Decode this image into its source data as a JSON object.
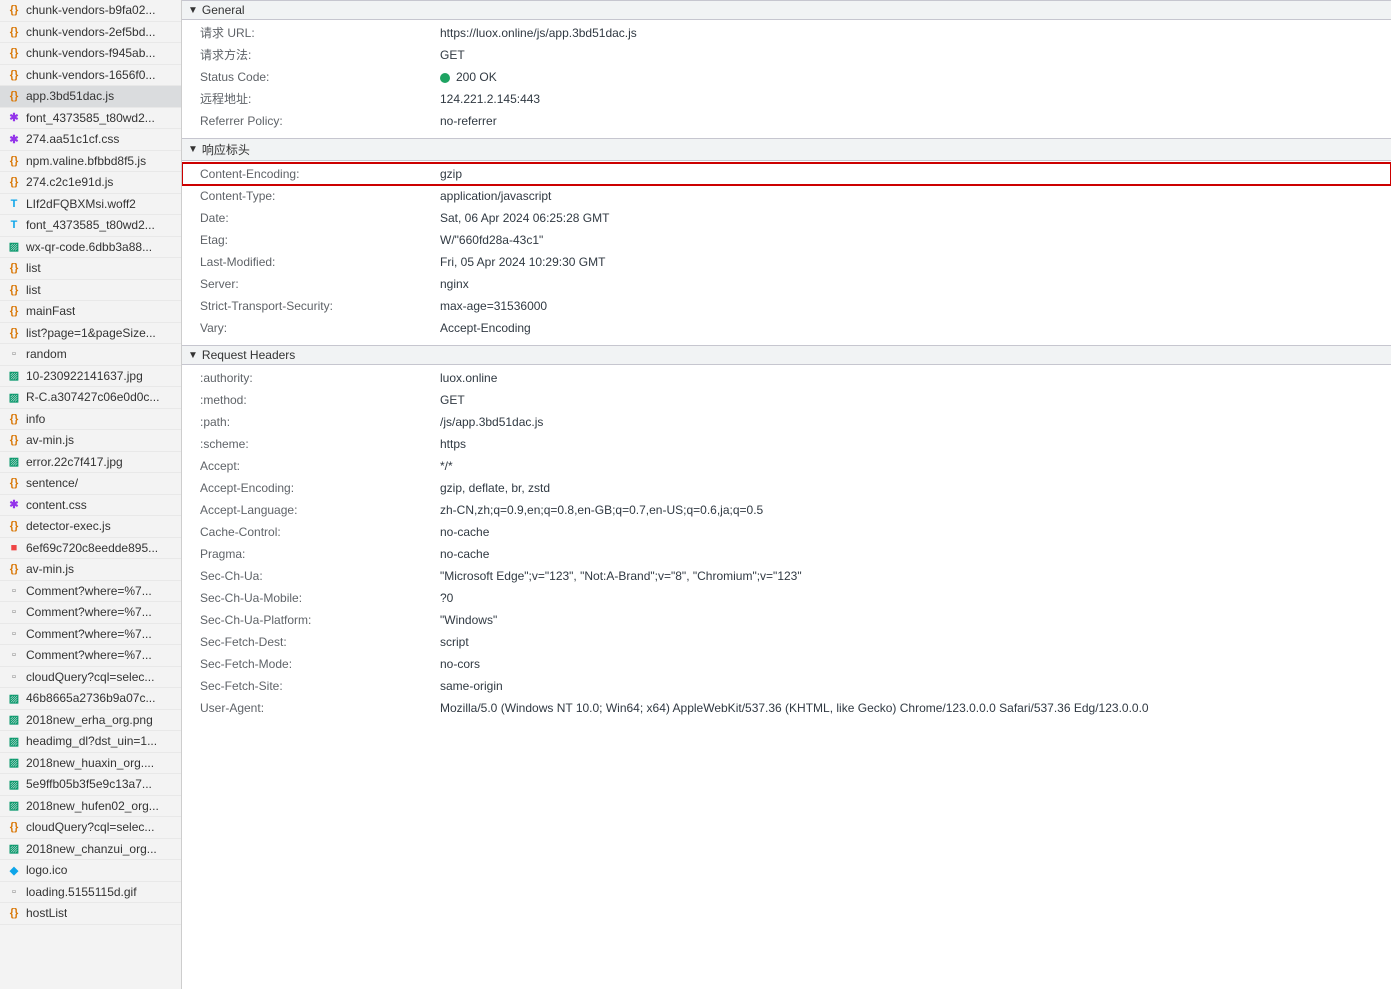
{
  "sidebar": {
    "items": [
      {
        "label": "chunk-vendors-b9fa02...",
        "icon": "js",
        "name": "file-chunk-vendors-1"
      },
      {
        "label": "chunk-vendors-2ef5bd...",
        "icon": "js",
        "name": "file-chunk-vendors-2"
      },
      {
        "label": "chunk-vendors-f945ab...",
        "icon": "js",
        "name": "file-chunk-vendors-3"
      },
      {
        "label": "chunk-vendors-1656f0...",
        "icon": "js",
        "name": "file-chunk-vendors-4"
      },
      {
        "label": "app.3bd51dac.js",
        "icon": "js",
        "name": "file-app-js",
        "selected": true
      },
      {
        "label": "font_4373585_t80wd2...",
        "icon": "css",
        "name": "file-font-css-1"
      },
      {
        "label": "274.aa51c1cf.css",
        "icon": "css",
        "name": "file-274-css"
      },
      {
        "label": "npm.valine.bfbbd8f5.js",
        "icon": "js",
        "name": "file-npm-valine"
      },
      {
        "label": "274.c2c1e91d.js",
        "icon": "js",
        "name": "file-274-js"
      },
      {
        "label": "LIf2dFQBXMsi.woff2",
        "icon": "font",
        "name": "file-woff2"
      },
      {
        "label": "font_4373585_t80wd2...",
        "icon": "font",
        "name": "file-font-2"
      },
      {
        "label": "wx-qr-code.6dbb3a88...",
        "icon": "img",
        "name": "file-wx-qr"
      },
      {
        "label": "list",
        "icon": "xhr",
        "name": "file-list-1"
      },
      {
        "label": "list",
        "icon": "xhr",
        "name": "file-list-2"
      },
      {
        "label": "mainFast",
        "icon": "xhr",
        "name": "file-mainfast"
      },
      {
        "label": "list?page=1&pageSize...",
        "icon": "xhr",
        "name": "file-list-page"
      },
      {
        "label": "random",
        "icon": "doc",
        "name": "file-random"
      },
      {
        "label": "10-230922141637.jpg",
        "icon": "img",
        "name": "file-jpg-1"
      },
      {
        "label": "R-C.a307427c06e0d0c...",
        "icon": "img",
        "name": "file-rc-img"
      },
      {
        "label": "info",
        "icon": "xhr",
        "name": "file-info"
      },
      {
        "label": "av-min.js",
        "icon": "js",
        "name": "file-avmin-1"
      },
      {
        "label": "error.22c7f417.jpg",
        "icon": "img",
        "name": "file-error-jpg"
      },
      {
        "label": "sentence/",
        "icon": "xhr",
        "name": "file-sentence"
      },
      {
        "label": "content.css",
        "icon": "css",
        "name": "file-content-css"
      },
      {
        "label": "detector-exec.js",
        "icon": "js",
        "name": "file-detector"
      },
      {
        "label": "6ef69c720c8eedde895...",
        "icon": "media",
        "name": "file-media-1"
      },
      {
        "label": "av-min.js",
        "icon": "js",
        "name": "file-avmin-2"
      },
      {
        "label": "Comment?where=%7...",
        "icon": "doc",
        "name": "file-comment-1"
      },
      {
        "label": "Comment?where=%7...",
        "icon": "doc",
        "name": "file-comment-2"
      },
      {
        "label": "Comment?where=%7...",
        "icon": "doc",
        "name": "file-comment-3"
      },
      {
        "label": "Comment?where=%7...",
        "icon": "doc",
        "name": "file-comment-4"
      },
      {
        "label": "cloudQuery?cql=selec...",
        "icon": "doc",
        "name": "file-cloudquery-1"
      },
      {
        "label": "46b8665a2736b9a07c...",
        "icon": "img",
        "name": "file-img-46b"
      },
      {
        "label": "2018new_erha_org.png",
        "icon": "img",
        "name": "file-erha"
      },
      {
        "label": "headimg_dl?dst_uin=1...",
        "icon": "img",
        "name": "file-headimg"
      },
      {
        "label": "2018new_huaxin_org....",
        "icon": "img",
        "name": "file-huaxin"
      },
      {
        "label": "5e9ffb05b3f5e9c13a7...",
        "icon": "img",
        "name": "file-5e9"
      },
      {
        "label": "2018new_hufen02_org...",
        "icon": "img",
        "name": "file-hufen"
      },
      {
        "label": "cloudQuery?cql=selec...",
        "icon": "xhr",
        "name": "file-cloudquery-2"
      },
      {
        "label": "2018new_chanzui_org...",
        "icon": "img",
        "name": "file-chanzui"
      },
      {
        "label": "logo.ico",
        "icon": "fav",
        "name": "file-logo-ico"
      },
      {
        "label": "loading.5155115d.gif",
        "icon": "gif",
        "name": "file-loading-gif"
      },
      {
        "label": "hostList",
        "icon": "xhr",
        "name": "file-hostlist"
      }
    ]
  },
  "sections": {
    "general": {
      "title": "General",
      "rows": [
        {
          "k": "请求 URL:",
          "v": "https://luox.online/js/app.3bd51dac.js"
        },
        {
          "k": "请求方法:",
          "v": "GET"
        },
        {
          "k": "Status Code:",
          "v": "200 OK",
          "status": true
        },
        {
          "k": "远程地址:",
          "v": "124.221.2.145:443"
        },
        {
          "k": "Referrer Policy:",
          "v": "no-referrer"
        }
      ]
    },
    "response": {
      "title": "响应标头",
      "rows": [
        {
          "k": "Content-Encoding:",
          "v": "gzip",
          "highlight": true
        },
        {
          "k": "Content-Type:",
          "v": "application/javascript"
        },
        {
          "k": "Date:",
          "v": "Sat, 06 Apr 2024 06:25:28 GMT"
        },
        {
          "k": "Etag:",
          "v": "W/\"660fd28a-43c1\""
        },
        {
          "k": "Last-Modified:",
          "v": "Fri, 05 Apr 2024 10:29:30 GMT"
        },
        {
          "k": "Server:",
          "v": "nginx"
        },
        {
          "k": "Strict-Transport-Security:",
          "v": "max-age=31536000"
        },
        {
          "k": "Vary:",
          "v": "Accept-Encoding"
        }
      ]
    },
    "request": {
      "title": "Request Headers",
      "rows": [
        {
          "k": ":authority:",
          "v": "luox.online"
        },
        {
          "k": ":method:",
          "v": "GET"
        },
        {
          "k": ":path:",
          "v": "/js/app.3bd51dac.js"
        },
        {
          "k": ":scheme:",
          "v": "https"
        },
        {
          "k": "Accept:",
          "v": "*/*"
        },
        {
          "k": "Accept-Encoding:",
          "v": "gzip, deflate, br, zstd"
        },
        {
          "k": "Accept-Language:",
          "v": "zh-CN,zh;q=0.9,en;q=0.8,en-GB;q=0.7,en-US;q=0.6,ja;q=0.5"
        },
        {
          "k": "Cache-Control:",
          "v": "no-cache"
        },
        {
          "k": "Pragma:",
          "v": "no-cache"
        },
        {
          "k": "Sec-Ch-Ua:",
          "v": "\"Microsoft Edge\";v=\"123\", \"Not:A-Brand\";v=\"8\", \"Chromium\";v=\"123\""
        },
        {
          "k": "Sec-Ch-Ua-Mobile:",
          "v": "?0"
        },
        {
          "k": "Sec-Ch-Ua-Platform:",
          "v": "\"Windows\""
        },
        {
          "k": "Sec-Fetch-Dest:",
          "v": "script"
        },
        {
          "k": "Sec-Fetch-Mode:",
          "v": "no-cors"
        },
        {
          "k": "Sec-Fetch-Site:",
          "v": "same-origin"
        },
        {
          "k": "User-Agent:",
          "v": "Mozilla/5.0 (Windows NT 10.0; Win64; x64) AppleWebKit/537.36 (KHTML, like Gecko) Chrome/123.0.0.0 Safari/537.36 Edg/123.0.0.0"
        }
      ]
    }
  },
  "icons": {
    "js": "{}",
    "css": "✱",
    "font": "T",
    "img": "▨",
    "doc": "▫",
    "xhr": "{}",
    "media": "■",
    "fav": "◆",
    "gif": "▫"
  }
}
